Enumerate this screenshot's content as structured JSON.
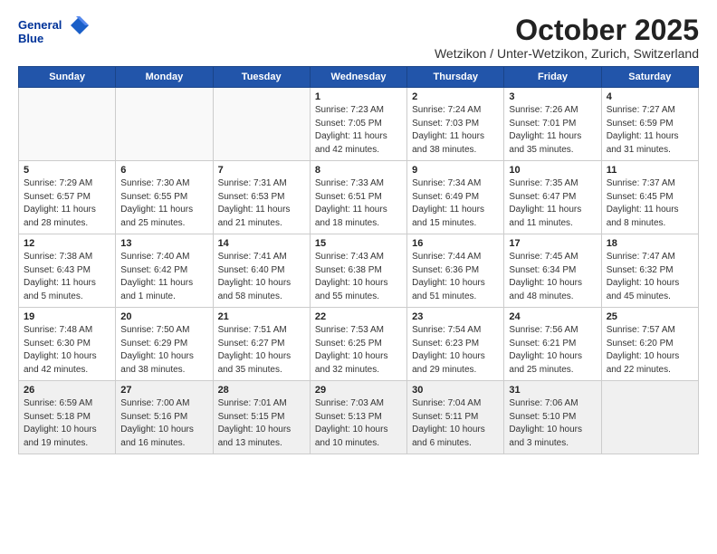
{
  "logo": {
    "line1": "General",
    "line2": "Blue"
  },
  "title": "October 2025",
  "subtitle": "Wetzikon / Unter-Wetzikon, Zurich, Switzerland",
  "weekdays": [
    "Sunday",
    "Monday",
    "Tuesday",
    "Wednesday",
    "Thursday",
    "Friday",
    "Saturday"
  ],
  "weeks": [
    [
      {
        "day": "",
        "info": ""
      },
      {
        "day": "",
        "info": ""
      },
      {
        "day": "",
        "info": ""
      },
      {
        "day": "1",
        "info": "Sunrise: 7:23 AM\nSunset: 7:05 PM\nDaylight: 11 hours\nand 42 minutes."
      },
      {
        "day": "2",
        "info": "Sunrise: 7:24 AM\nSunset: 7:03 PM\nDaylight: 11 hours\nand 38 minutes."
      },
      {
        "day": "3",
        "info": "Sunrise: 7:26 AM\nSunset: 7:01 PM\nDaylight: 11 hours\nand 35 minutes."
      },
      {
        "day": "4",
        "info": "Sunrise: 7:27 AM\nSunset: 6:59 PM\nDaylight: 11 hours\nand 31 minutes."
      }
    ],
    [
      {
        "day": "5",
        "info": "Sunrise: 7:29 AM\nSunset: 6:57 PM\nDaylight: 11 hours\nand 28 minutes."
      },
      {
        "day": "6",
        "info": "Sunrise: 7:30 AM\nSunset: 6:55 PM\nDaylight: 11 hours\nand 25 minutes."
      },
      {
        "day": "7",
        "info": "Sunrise: 7:31 AM\nSunset: 6:53 PM\nDaylight: 11 hours\nand 21 minutes."
      },
      {
        "day": "8",
        "info": "Sunrise: 7:33 AM\nSunset: 6:51 PM\nDaylight: 11 hours\nand 18 minutes."
      },
      {
        "day": "9",
        "info": "Sunrise: 7:34 AM\nSunset: 6:49 PM\nDaylight: 11 hours\nand 15 minutes."
      },
      {
        "day": "10",
        "info": "Sunrise: 7:35 AM\nSunset: 6:47 PM\nDaylight: 11 hours\nand 11 minutes."
      },
      {
        "day": "11",
        "info": "Sunrise: 7:37 AM\nSunset: 6:45 PM\nDaylight: 11 hours\nand 8 minutes."
      }
    ],
    [
      {
        "day": "12",
        "info": "Sunrise: 7:38 AM\nSunset: 6:43 PM\nDaylight: 11 hours\nand 5 minutes."
      },
      {
        "day": "13",
        "info": "Sunrise: 7:40 AM\nSunset: 6:42 PM\nDaylight: 11 hours\nand 1 minute."
      },
      {
        "day": "14",
        "info": "Sunrise: 7:41 AM\nSunset: 6:40 PM\nDaylight: 10 hours\nand 58 minutes."
      },
      {
        "day": "15",
        "info": "Sunrise: 7:43 AM\nSunset: 6:38 PM\nDaylight: 10 hours\nand 55 minutes."
      },
      {
        "day": "16",
        "info": "Sunrise: 7:44 AM\nSunset: 6:36 PM\nDaylight: 10 hours\nand 51 minutes."
      },
      {
        "day": "17",
        "info": "Sunrise: 7:45 AM\nSunset: 6:34 PM\nDaylight: 10 hours\nand 48 minutes."
      },
      {
        "day": "18",
        "info": "Sunrise: 7:47 AM\nSunset: 6:32 PM\nDaylight: 10 hours\nand 45 minutes."
      }
    ],
    [
      {
        "day": "19",
        "info": "Sunrise: 7:48 AM\nSunset: 6:30 PM\nDaylight: 10 hours\nand 42 minutes."
      },
      {
        "day": "20",
        "info": "Sunrise: 7:50 AM\nSunset: 6:29 PM\nDaylight: 10 hours\nand 38 minutes."
      },
      {
        "day": "21",
        "info": "Sunrise: 7:51 AM\nSunset: 6:27 PM\nDaylight: 10 hours\nand 35 minutes."
      },
      {
        "day": "22",
        "info": "Sunrise: 7:53 AM\nSunset: 6:25 PM\nDaylight: 10 hours\nand 32 minutes."
      },
      {
        "day": "23",
        "info": "Sunrise: 7:54 AM\nSunset: 6:23 PM\nDaylight: 10 hours\nand 29 minutes."
      },
      {
        "day": "24",
        "info": "Sunrise: 7:56 AM\nSunset: 6:21 PM\nDaylight: 10 hours\nand 25 minutes."
      },
      {
        "day": "25",
        "info": "Sunrise: 7:57 AM\nSunset: 6:20 PM\nDaylight: 10 hours\nand 22 minutes."
      }
    ],
    [
      {
        "day": "26",
        "info": "Sunrise: 6:59 AM\nSunset: 5:18 PM\nDaylight: 10 hours\nand 19 minutes."
      },
      {
        "day": "27",
        "info": "Sunrise: 7:00 AM\nSunset: 5:16 PM\nDaylight: 10 hours\nand 16 minutes."
      },
      {
        "day": "28",
        "info": "Sunrise: 7:01 AM\nSunset: 5:15 PM\nDaylight: 10 hours\nand 13 minutes."
      },
      {
        "day": "29",
        "info": "Sunrise: 7:03 AM\nSunset: 5:13 PM\nDaylight: 10 hours\nand 10 minutes."
      },
      {
        "day": "30",
        "info": "Sunrise: 7:04 AM\nSunset: 5:11 PM\nDaylight: 10 hours\nand 6 minutes."
      },
      {
        "day": "31",
        "info": "Sunrise: 7:06 AM\nSunset: 5:10 PM\nDaylight: 10 hours\nand 3 minutes."
      },
      {
        "day": "",
        "info": ""
      }
    ]
  ]
}
